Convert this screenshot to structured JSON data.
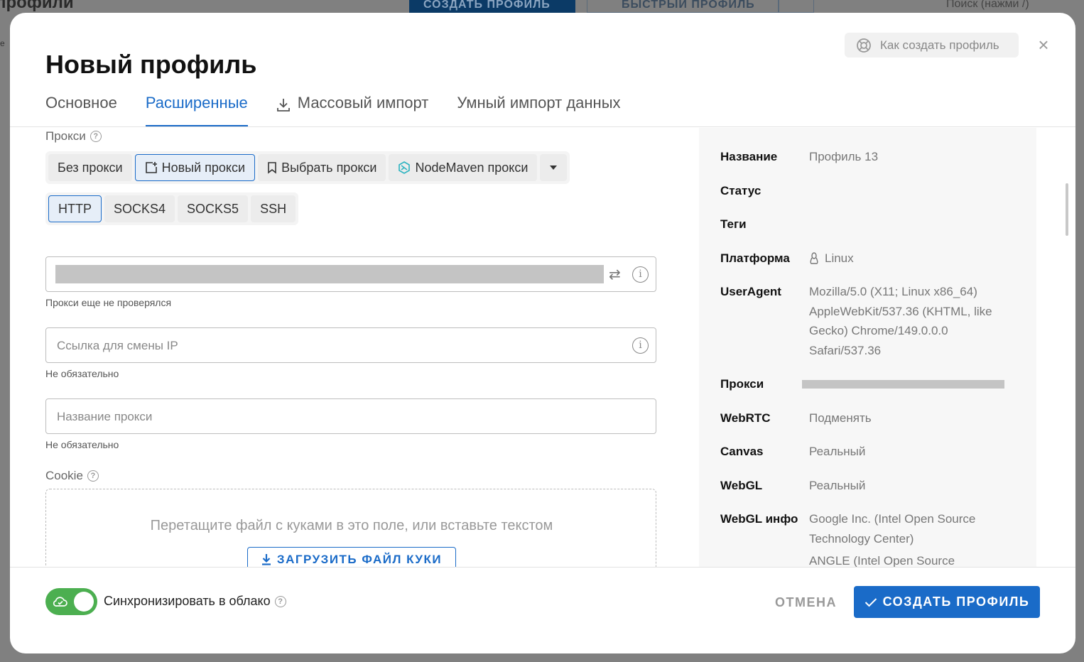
{
  "background": {
    "title": "профили",
    "create_button": "СОЗДАТЬ ПРОФИЛЬ",
    "quick_button": "БЫСТРЫЙ ПРОФИЛЬ",
    "search_placeholder": "Поиск (нажми /)",
    "left_fragment": "е"
  },
  "modal": {
    "title": "Новый профиль",
    "help_button": "Как создать профиль",
    "close": "×"
  },
  "tabs": [
    {
      "label": "Основное"
    },
    {
      "label": "Расширенные",
      "active": true
    },
    {
      "label": "Массовый импорт",
      "icon": "download-icon"
    },
    {
      "label": "Умный импорт данных"
    }
  ],
  "proxy": {
    "label": "Прокси",
    "modes": [
      "Без прокси",
      "Новый прокси",
      "Выбрать прокси",
      "NodeMaven прокси"
    ],
    "selected_mode": "Новый прокси",
    "types": [
      "HTTP",
      "SOCKS4",
      "SOCKS5",
      "SSH"
    ],
    "selected_type": "HTTP",
    "status_hint": "Прокси еще не проверялся",
    "change_ip_placeholder": "Ссылка для смены IP",
    "change_ip_hint": "Не обязательно",
    "name_placeholder": "Название прокси",
    "name_hint": "Не обязательно"
  },
  "cookie": {
    "label": "Cookie",
    "drop_text": "Перетащите файл с куками в это поле, или вставьте текстом",
    "upload_button": "ЗАГРУЗИТЬ ФАЙЛ КУКИ"
  },
  "summary": {
    "name_key": "Название",
    "name_val": "Профиль 13",
    "status_key": "Статус",
    "status_val": "",
    "tags_key": "Теги",
    "tags_val": "",
    "platform_key": "Платформа",
    "platform_val": "Linux",
    "ua_key": "UserAgent",
    "ua_val": "Mozilla/5.0 (X11; Linux x86_64) AppleWebKit/537.36 (KHTML, like Gecko) Chrome/149.0.0.0 Safari/537.36",
    "proxy_key": "Прокси",
    "webrtc_key": "WebRTC",
    "webrtc_val": "Подменять",
    "canvas_key": "Canvas",
    "canvas_val": "Реальный",
    "webgl_key": "WebGL",
    "webgl_val": "Реальный",
    "webglinfo_key": "WebGL инфо",
    "webglinfo_val": "Google Inc. (Intel Open Source Technology Center)",
    "webglinfo_val2": "ANGLE (Intel Open Source"
  },
  "footer": {
    "sync_label": "Синхронизировать в облако",
    "sync_enabled": true,
    "cancel": "ОТМЕНА",
    "create": "СОЗДАТЬ ПРОФИЛЬ"
  },
  "colors": {
    "accent": "#1a6bc8",
    "toggle_on": "#4caf50"
  }
}
